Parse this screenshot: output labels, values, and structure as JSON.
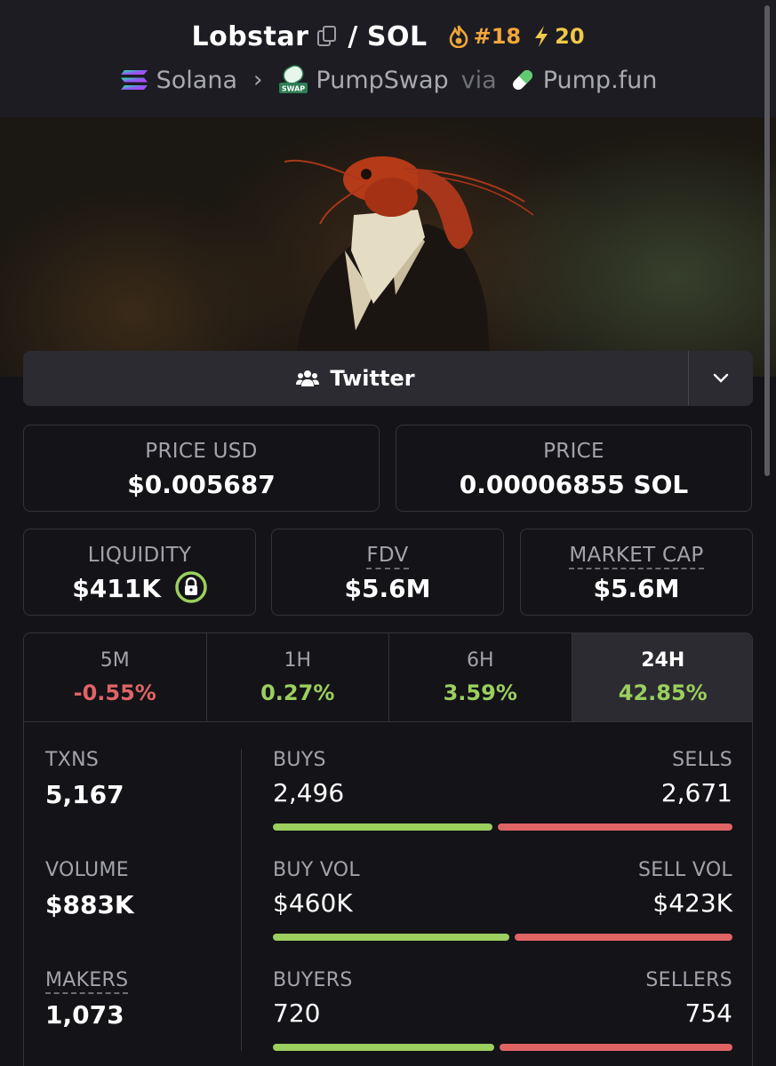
{
  "header": {
    "token_name": "Lobstar",
    "separator": "/",
    "quote": "SOL",
    "rank": "#18",
    "boosts": "20",
    "chain": "Solana",
    "dex": "PumpSwap",
    "via": "via",
    "launchpad": "Pump.fun",
    "swap_badge": "SWAP"
  },
  "social": {
    "twitter_label": "Twitter"
  },
  "price": {
    "usd_label": "PRICE USD",
    "usd_value": "$0.005687",
    "native_label": "PRICE",
    "native_value": "0.00006855 SOL"
  },
  "metrics": {
    "liquidity_label": "LIQUIDITY",
    "liquidity_value": "$411K",
    "fdv_label": "FDV",
    "fdv_value": "$5.6M",
    "mcap_label": "MARKET CAP",
    "mcap_value": "$5.6M"
  },
  "changes": [
    {
      "label": "5M",
      "value": "-0.55%",
      "trend": "neg"
    },
    {
      "label": "1H",
      "value": "0.27%",
      "trend": "pos"
    },
    {
      "label": "6H",
      "value": "3.59%",
      "trend": "pos"
    },
    {
      "label": "24H",
      "value": "42.85%",
      "trend": "pos",
      "active": true
    }
  ],
  "stats": {
    "txns_label": "TXNS",
    "txns_value": "5,167",
    "volume_label": "VOLUME",
    "volume_value": "$883K",
    "makers_label": "MAKERS",
    "makers_value": "1,073"
  },
  "ratios": {
    "buys_label": "BUYS",
    "buys_value": "2,496",
    "sells_label": "SELLS",
    "sells_value": "2,671",
    "buys_fraction": 0.483,
    "buy_vol_label": "BUY VOL",
    "buy_vol_value": "$460K",
    "sell_vol_label": "SELL VOL",
    "sell_vol_value": "$423K",
    "buy_vol_fraction": 0.521,
    "buyers_label": "BUYERS",
    "buyers_value": "720",
    "sellers_label": "SELLERS",
    "sellers_value": "754",
    "buyers_fraction": 0.488
  },
  "colors": {
    "green": "#9bcf5e",
    "red": "#e06464",
    "orange": "#f0a63a",
    "background": "#131318"
  }
}
